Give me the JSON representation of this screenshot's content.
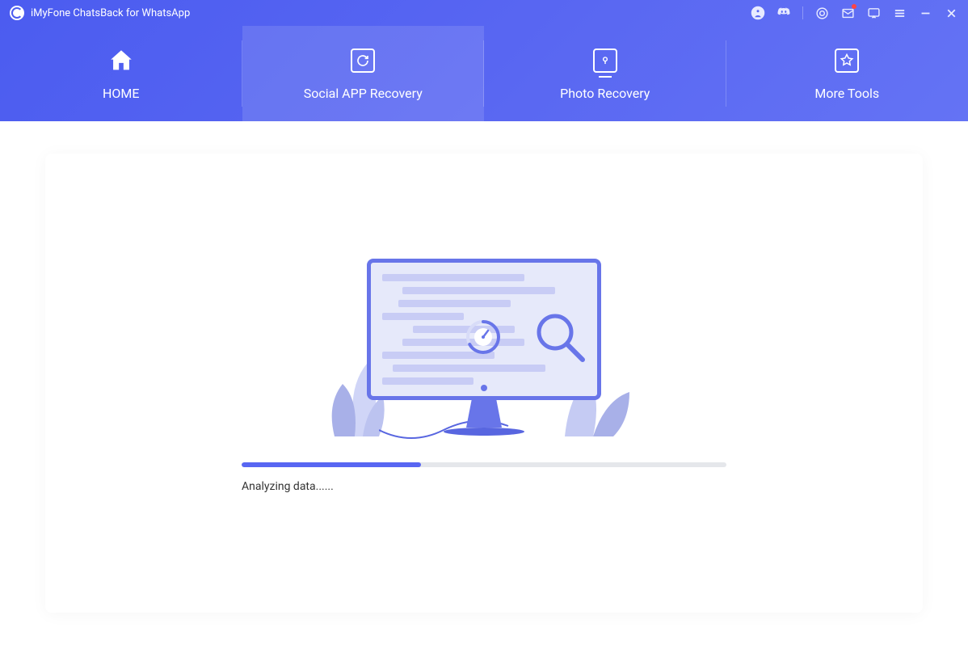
{
  "app": {
    "title": "iMyFone ChatsBack for WhatsApp"
  },
  "nav": {
    "home": "HOME",
    "social": "Social APP Recovery",
    "photo": "Photo Recovery",
    "tools": "More Tools"
  },
  "progress": {
    "percent": 37,
    "status": "Analyzing data......"
  }
}
